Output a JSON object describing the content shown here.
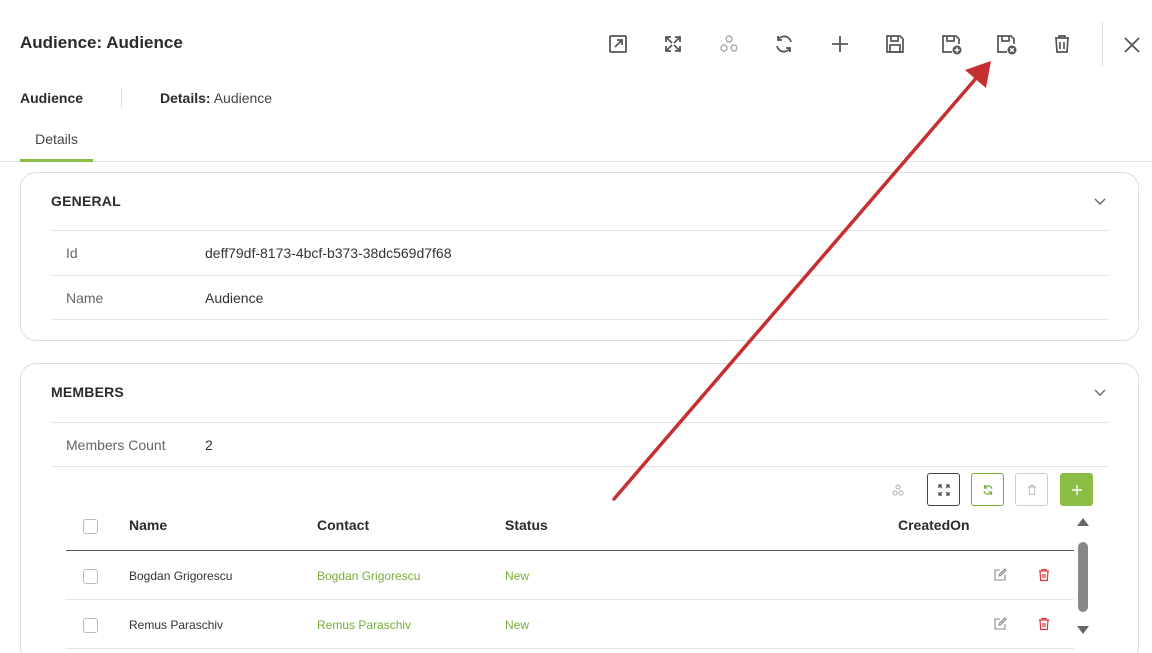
{
  "header": {
    "title": "Audience: Audience",
    "toolbar_icons": [
      "open-in-new-window-icon",
      "maximize-icon",
      "hierarchy-icon",
      "refresh-icon",
      "plus-icon",
      "save-icon",
      "save-and-new-icon",
      "save-and-close-icon",
      "trash-icon"
    ],
    "close_icon": "close-icon"
  },
  "subheader": {
    "entity": "Audience",
    "details_label": "Details:",
    "details_value": "Audience"
  },
  "tabs": [
    {
      "label": "Details",
      "active": true
    }
  ],
  "general": {
    "title": "GENERAL",
    "fields": [
      {
        "label": "Id",
        "value": "deff79df-8173-4bcf-b373-38dc569d7f68"
      },
      {
        "label": "Name",
        "value": "Audience"
      }
    ]
  },
  "members": {
    "title": "MEMBERS",
    "count_label": "Members Count",
    "count_value": "2",
    "columns": [
      "Name",
      "Contact",
      "Status",
      "CreatedOn"
    ],
    "rows": [
      {
        "name": "Bogdan Grigorescu",
        "contact": "Bogdan Grigorescu",
        "status": "New",
        "created_on": ""
      },
      {
        "name": "Remus Paraschiv",
        "contact": "Remus Paraschiv",
        "status": "New",
        "created_on": ""
      }
    ]
  },
  "colors": {
    "accent_green": "#8bbd45",
    "link_green": "#7aac3a",
    "delete_red": "#d9363e",
    "annotation_arrow": "#c62f2f"
  }
}
